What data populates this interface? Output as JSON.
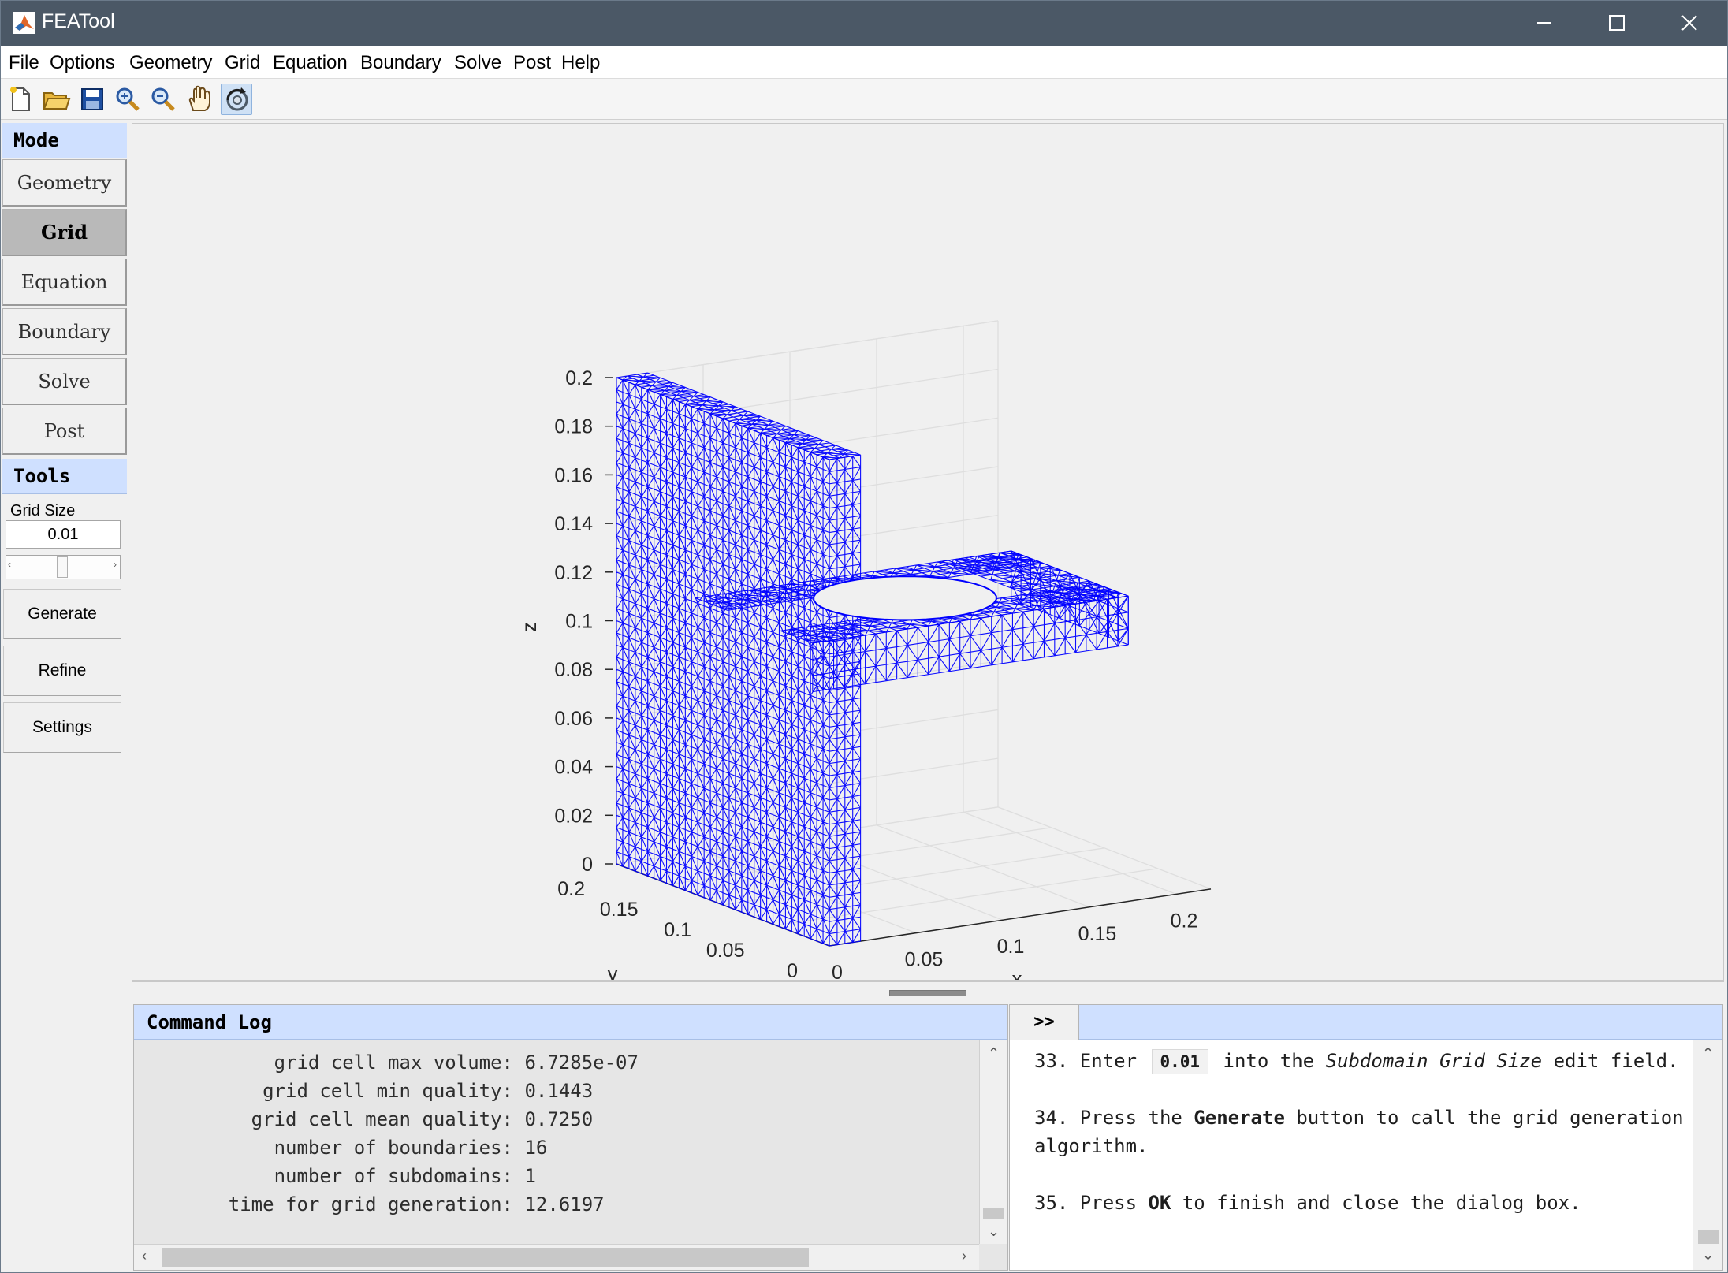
{
  "window": {
    "title": "FEATool",
    "minimize_icon": "minimize-icon",
    "maximize_icon": "maximize-icon",
    "close_icon": "close-icon"
  },
  "menu": [
    "File",
    "Options",
    "Geometry",
    "Grid",
    "Equation",
    "Boundary",
    "Solve",
    "Post",
    "Help"
  ],
  "toolbar": {
    "icons": [
      "new-file-icon",
      "open-folder-icon",
      "save-icon",
      "zoom-in-icon",
      "zoom-out-icon",
      "pan-hand-icon",
      "rotate-3d-icon"
    ],
    "active": "rotate-3d-icon"
  },
  "sidebar": {
    "mode_header": "Mode",
    "modes": [
      "Geometry",
      "Grid",
      "Equation",
      "Boundary",
      "Solve",
      "Post"
    ],
    "selected_mode": "Grid",
    "tools_header": "Tools",
    "grid_size_label": "Grid Size",
    "grid_size_value": "0.01",
    "slider_position": 0.5,
    "buttons": [
      "Generate",
      "Refine",
      "Settings"
    ]
  },
  "plot": {
    "mesh_color": "#0000ff",
    "z_ticks": [
      "0.2",
      "0.18",
      "0.16",
      "0.14",
      "0.12",
      "0.1",
      "0.08",
      "0.06",
      "0.04",
      "0.02",
      "0"
    ],
    "y_ticks": [
      "0.2",
      "0.15",
      "0.1",
      "0.05",
      "0"
    ],
    "x_ticks": [
      "0",
      "0.05",
      "0.1",
      "0.15",
      "0.2"
    ],
    "xlabel": "x",
    "ylabel": "y",
    "zlabel": "z"
  },
  "command_log": {
    "title": "Command Log",
    "lines": [
      {
        "label": "grid cell max volume:",
        "value": "6.7285e-07"
      },
      {
        "label": "grid cell min quality:",
        "value": "0.1443"
      },
      {
        "label": "grid cell mean quality:",
        "value": "0.7250"
      },
      {
        "label": "number of boundaries:",
        "value": "16"
      },
      {
        "label": "number of subdomains:",
        "value": "1"
      },
      {
        "label": "time for grid generation:",
        "value": "12.6197"
      }
    ]
  },
  "help": {
    "toggle": ">>",
    "step33": {
      "pre": "33. Enter",
      "code": "0.01",
      "mid": "into the",
      "em": "Subdomain Grid Size",
      "post": "edit field."
    },
    "step34": {
      "pre": "34. Press the",
      "strong": "Generate",
      "post": "button to call the grid generation algorithm."
    },
    "step35": {
      "pre": "35. Press",
      "strong": "OK",
      "post": "to finish and close the dialog box."
    }
  }
}
